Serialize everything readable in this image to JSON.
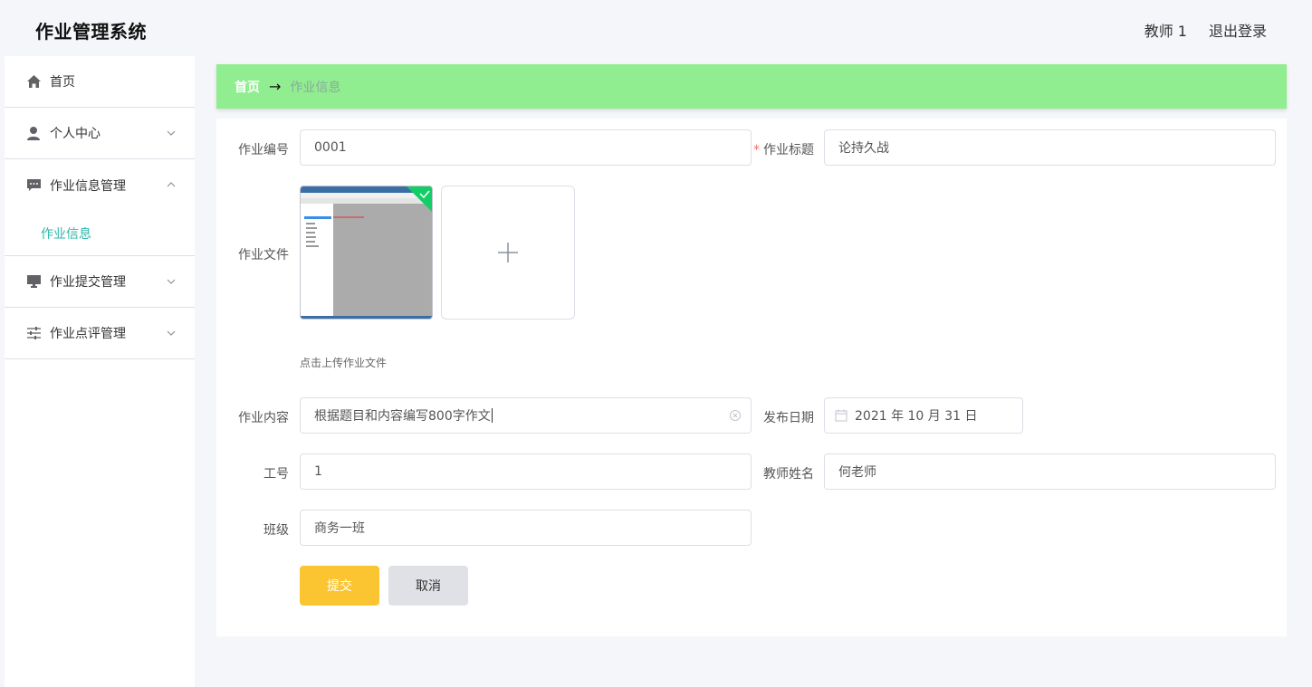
{
  "header": {
    "title": "作业管理系统",
    "user": "教师 1",
    "logout": "退出登录"
  },
  "sidebar": {
    "items": [
      {
        "label": "首页",
        "icon": "home-icon"
      },
      {
        "label": "个人中心",
        "icon": "user-icon"
      },
      {
        "label": "作业信息管理",
        "icon": "message-icon",
        "expanded": true,
        "children": [
          {
            "label": "作业信息"
          }
        ]
      },
      {
        "label": "作业提交管理",
        "icon": "monitor-icon"
      },
      {
        "label": "作业点评管理",
        "icon": "sliders-icon"
      }
    ]
  },
  "breadcrumb": {
    "home": "首页",
    "separator": "→",
    "current": "作业信息"
  },
  "form": {
    "code_label": "作业编号",
    "code_value": "0001",
    "title_required": "*",
    "title_label": "作业标题",
    "title_value": "论持久战",
    "file_label": "作业文件",
    "file_hint": "点击上传作业文件",
    "content_label": "作业内容",
    "content_value": "根据题目和内容编写800字作文",
    "date_label": "发布日期",
    "date_value": "2021 年 10 月 31 日",
    "job_no_label": "工号",
    "job_no_value": "1",
    "teacher_label": "教师姓名",
    "teacher_value": "何老师",
    "class_label": "班级",
    "class_value": "商务一班",
    "submit": "提交",
    "cancel": "取消"
  },
  "colors": {
    "breadcrumb_bg": "#90ee90",
    "submit_bg": "#fbc531",
    "cancel_bg": "#dfe1e6",
    "active_submenu": "#2db7a8",
    "success_badge": "#13ce66"
  }
}
